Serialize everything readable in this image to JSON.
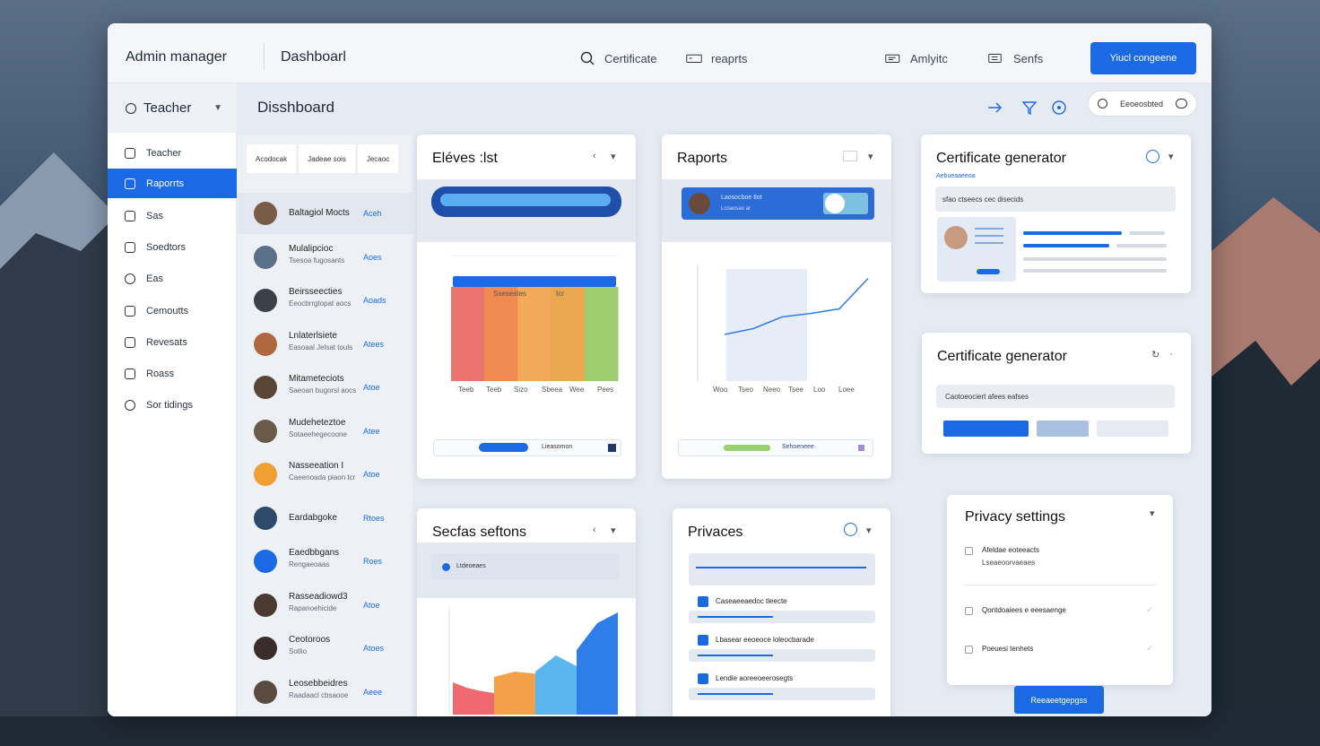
{
  "app": {
    "brand": "Admin manager",
    "crumb": "Dashboarl"
  },
  "topnav": [
    {
      "label": "Certificate",
      "icon": "search-icon"
    },
    {
      "label": "reaprts",
      "icon": "card-icon"
    },
    {
      "label": "Amlyitc",
      "icon": "id-card-icon"
    },
    {
      "label": "Senfs",
      "icon": "list-icon"
    }
  ],
  "primary_button": "Yiucl congeene",
  "sidebar": {
    "role": "Teacher",
    "items": [
      {
        "label": "Teacher",
        "active": false
      },
      {
        "label": "Raporrts",
        "active": true
      },
      {
        "label": "Sas",
        "active": false
      },
      {
        "label": "Soedtors",
        "active": false
      },
      {
        "label": "Eas",
        "active": false
      },
      {
        "label": "Cemoutts",
        "active": false
      },
      {
        "label": "Revesats",
        "active": false
      },
      {
        "label": "Roass",
        "active": false
      },
      {
        "label": "Sor tidings",
        "active": false
      }
    ]
  },
  "page_title": "Disshboard",
  "filter_pill": "Eeoeosbted",
  "list": {
    "tabs": [
      "Acodocak",
      "Jadeae sois",
      "Jecaoc"
    ],
    "rows": [
      {
        "name": "Baltagiol Mocts",
        "sub": "",
        "tag": "Aceh",
        "color": "#7a5a48"
      },
      {
        "name": "Mulalipcioc",
        "sub": "Tsesoa fugosants",
        "tag": "Aoes",
        "color": "#5a6f88"
      },
      {
        "name": "Beirsseecties",
        "sub": "Eeocbrrgtopat aocs",
        "tag": "Aoads",
        "color": "#3a4048"
      },
      {
        "name": "Lnlaterlsiete",
        "sub": "Easoaal Jelsat touls",
        "tag": "Atees",
        "color": "#b0683e"
      },
      {
        "name": "Mitameteciots",
        "sub": "Saeoan bugorsl aocs",
        "tag": "Atoe",
        "color": "#5b4636"
      },
      {
        "name": "Mudeheteztoe",
        "sub": "Sotaeehegecoone",
        "tag": "Atee",
        "color": "#6b5a4a"
      },
      {
        "name": "Nasseeation I",
        "sub": "Caeenoada piaon tcr",
        "tag": "Atoe",
        "color": "#f0a030"
      },
      {
        "name": "Eardabgoke",
        "sub": "",
        "tag": "Rtoes",
        "color": "#2e4a6a"
      },
      {
        "name": "Eaedbbgans",
        "sub": "Rengaeoaas",
        "tag": "Roes",
        "color": "#1b6ae4"
      },
      {
        "name": "Rasseadiowd3",
        "sub": "Rapanoehicide",
        "tag": "Atoe",
        "color": "#4a3a30"
      },
      {
        "name": "Ceotoroos",
        "sub": "Sotlio",
        "tag": "Atoes",
        "color": "#3a2c28"
      },
      {
        "name": "Leosebbeidres",
        "sub": "Raadaacl cbsaooe",
        "tag": "Aeee",
        "color": "#5a4a40"
      }
    ]
  },
  "cards": {
    "eleves": {
      "title": "Eléves :lst",
      "foot": "Lieasomon"
    },
    "raports": {
      "title": "Raports",
      "banner": "Laosocboe tlot",
      "banner_sub": "Lcoaosao ar",
      "foot": "Sehoeneee"
    },
    "cert1": {
      "title": "Certificate generator",
      "sub": "Aebueaaeeoa",
      "field": "sfao ctseecs cec disecids"
    },
    "cert2": {
      "title": "Certificate generator",
      "field": "Caotoeociert afees eafses"
    },
    "secfas": {
      "title": "Secfas seftons",
      "row": "Ltdeoeaes"
    },
    "privaces": {
      "title": "Privaces",
      "items": [
        "Caseaeeaedoc tleecte",
        "Lbasear eeoeoce loleocbarade",
        "Lendie aoreeoeerosegts"
      ]
    },
    "privacy": {
      "title": "Privacy settings",
      "items": [
        {
          "label": "Afeldae eoteeacts",
          "sub": "Lseaeoorvaeaes"
        },
        {
          "label": "Qontdoaiees e eeesaenge",
          "sub": ""
        },
        {
          "label": "Poeuesi tenhets",
          "sub": ""
        }
      ],
      "button": "Reeaeetgepgss"
    }
  },
  "chart_data": [
    {
      "type": "bar",
      "title": "",
      "categories": [
        "Teeb",
        "Teeb",
        "Sizo",
        "Sbeea",
        "Wee",
        "Pees"
      ],
      "series": [
        {
          "values": [
            75,
            75,
            75,
            75,
            75,
            75
          ]
        }
      ],
      "band_labels": [
        "Ssesestes",
        "Icr"
      ],
      "colors": [
        "#ea7570",
        "#f08a50",
        "#f2aa5a",
        "#e9a74f",
        "#9dcd6e"
      ],
      "ylim": [
        0,
        100
      ]
    },
    {
      "type": "line",
      "title": "",
      "categories": [
        "Woo",
        "Tseo",
        "Neeo",
        "Tsee",
        "Loo",
        "Loee"
      ],
      "series": [
        {
          "values": [
            40,
            45,
            55,
            58,
            62,
            88
          ]
        }
      ],
      "ylim": [
        0,
        100
      ]
    },
    {
      "type": "area",
      "title": "",
      "series": [
        {
          "values": [
            30,
            25,
            22,
            20
          ],
          "color": "#ee6a6e"
        },
        {
          "values": [
            35,
            40,
            38
          ],
          "color": "#f3a04a"
        },
        {
          "values": [
            40,
            55,
            45
          ],
          "color": "#5bb6f0"
        },
        {
          "values": [
            60,
            85,
            95
          ],
          "color": "#2f7de6"
        }
      ],
      "ylim": [
        0,
        100
      ]
    }
  ],
  "colors": {
    "accent": "#1b6ae4",
    "bg": "#e6ebf3"
  }
}
